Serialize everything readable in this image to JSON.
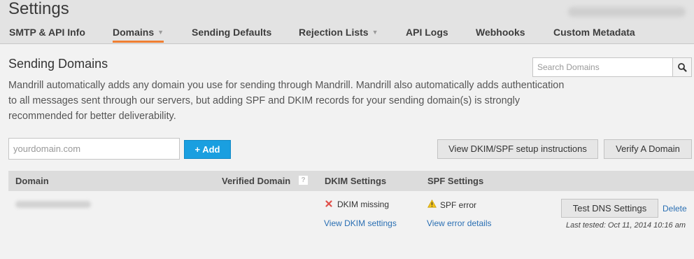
{
  "app": {
    "title": "Settings"
  },
  "tabs": [
    {
      "label": "SMTP & API Info"
    },
    {
      "label": "Domains"
    },
    {
      "label": "Sending Defaults"
    },
    {
      "label": "Rejection Lists"
    },
    {
      "label": "API Logs"
    },
    {
      "label": "Webhooks"
    },
    {
      "label": "Custom Metadata"
    }
  ],
  "section": {
    "heading": "Sending Domains",
    "description": "Mandrill automatically adds any domain you use for sending through Mandrill. Mandrill also automatically adds authentication to all messages sent through our servers, but adding SPF and DKIM records for your sending domain(s) is strongly recommended for better deliverability."
  },
  "search": {
    "placeholder": "Search Domains",
    "icon": "search-icon"
  },
  "add_form": {
    "placeholder": "yourdomain.com",
    "add_label": "+ Add"
  },
  "actions": {
    "instructions_label": "View DKIM/SPF setup instructions",
    "verify_label": "Verify A Domain"
  },
  "table": {
    "headers": {
      "domain": "Domain",
      "verified": "Verified Domain",
      "verified_help": "?",
      "dkim": "DKIM Settings",
      "spf": "SPF Settings"
    },
    "rows": [
      {
        "dkim_status": "DKIM missing",
        "dkim_icon": "x-icon",
        "dkim_link": "View DKIM settings",
        "spf_status": "SPF error",
        "spf_icon": "warning-icon",
        "spf_link": "View error details",
        "test_label": "Test DNS Settings",
        "delete_label": "Delete",
        "last_tested": "Last tested: Oct 11, 2014 10:16 am"
      }
    ]
  },
  "colors": {
    "accent": "#f07f32",
    "primary_button": "#1a9fe0",
    "link": "#2a6fb3",
    "error": "#e0504a",
    "warning": "#f2c318"
  }
}
